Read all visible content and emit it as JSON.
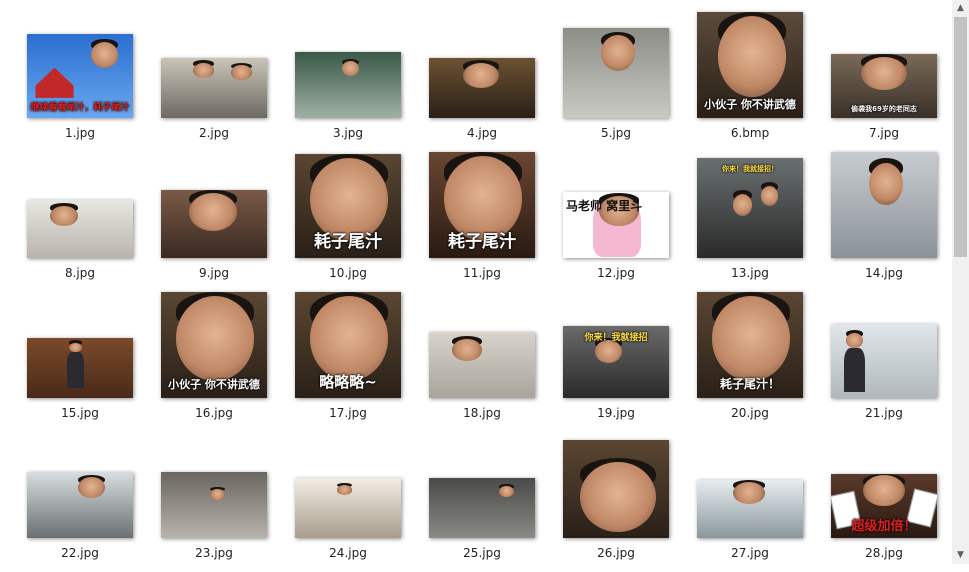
{
  "files": [
    {
      "name": "1.jpg",
      "caption": "继续看看尾汁，耗子尾汁"
    },
    {
      "name": "2.jpg",
      "caption": ""
    },
    {
      "name": "3.jpg",
      "caption": ""
    },
    {
      "name": "4.jpg",
      "caption": ""
    },
    {
      "name": "5.jpg",
      "caption": ""
    },
    {
      "name": "6.bmp",
      "caption": "小伙子 你不讲武德"
    },
    {
      "name": "7.jpg",
      "caption": "偷袭我69岁的老同志"
    },
    {
      "name": "8.jpg",
      "caption": ""
    },
    {
      "name": "9.jpg",
      "caption": ""
    },
    {
      "name": "10.jpg",
      "caption": "耗子尾汁"
    },
    {
      "name": "11.jpg",
      "caption": "耗子尾汁"
    },
    {
      "name": "12.jpg",
      "caption": "马老师 窝里斗"
    },
    {
      "name": "13.jpg",
      "caption": "你来！我就接招！"
    },
    {
      "name": "14.jpg",
      "caption": ""
    },
    {
      "name": "15.jpg",
      "caption": ""
    },
    {
      "name": "16.jpg",
      "caption": "小伙子 你不讲武德"
    },
    {
      "name": "17.jpg",
      "caption": "略略略~"
    },
    {
      "name": "18.jpg",
      "caption": ""
    },
    {
      "name": "19.jpg",
      "caption": "你来！我就接招"
    },
    {
      "name": "20.jpg",
      "caption": "耗子尾汁！"
    },
    {
      "name": "21.jpg",
      "caption": ""
    },
    {
      "name": "22.jpg",
      "caption": ""
    },
    {
      "name": "23.jpg",
      "caption": ""
    },
    {
      "name": "24.jpg",
      "caption": ""
    },
    {
      "name": "25.jpg",
      "caption": ""
    },
    {
      "name": "26.jpg",
      "caption": ""
    },
    {
      "name": "27.jpg",
      "caption": ""
    },
    {
      "name": "28.jpg",
      "caption": "超级加倍！"
    }
  ],
  "colors": {
    "background": "#ffffff",
    "caption_white": "#ffffff",
    "pink": "#f4b8d0",
    "red": "#e02020",
    "scrollbar_track": "#f0f0f0",
    "scrollbar_thumb": "#c2c2c2"
  },
  "scrollbar": {
    "up_icon": "▲",
    "down_icon": "▼"
  }
}
